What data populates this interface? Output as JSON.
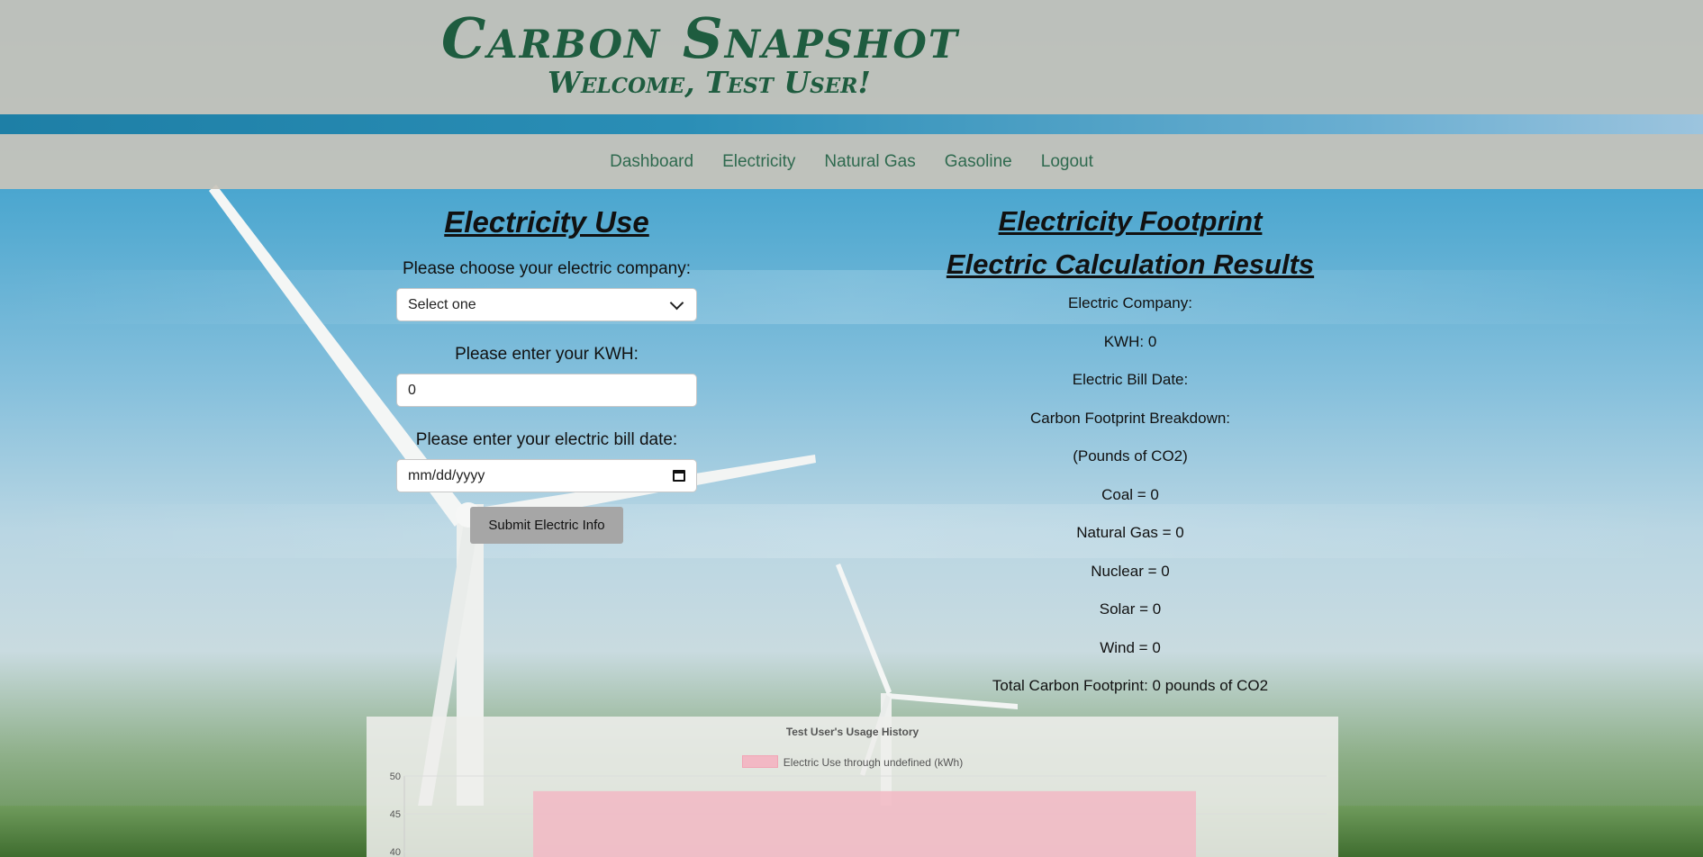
{
  "header": {
    "title": "Carbon Snapshot",
    "welcome": "Welcome, Test User!"
  },
  "nav": {
    "items": [
      "Dashboard",
      "Electricity",
      "Natural Gas",
      "Gasoline",
      "Logout"
    ]
  },
  "form": {
    "title": "Electricity Use",
    "company_label": "Please choose your electric company:",
    "company_value": "Select one",
    "kwh_label": "Please enter your KWH:",
    "kwh_value": "0",
    "date_label": "Please enter your electric bill date:",
    "date_placeholder": "mm/dd/yyyy",
    "submit_label": "Submit Electric Info"
  },
  "results": {
    "title": "Electricity Footprint",
    "subtitle": "Electric Calculation Results",
    "lines": [
      "Electric Company:",
      "KWH: 0",
      "Electric Bill Date:",
      "Carbon Footprint Breakdown:",
      "(Pounds of CO2)",
      "Coal = 0",
      "Natural Gas = 0",
      "Nuclear = 0",
      "Solar = 0",
      "Wind = 0",
      "Total Carbon Footprint: 0 pounds of CO2"
    ]
  },
  "chart_data": {
    "type": "bar",
    "title": "Test User's Usage History",
    "series": [
      {
        "name": "Electric Use through undefined (kWh)",
        "values": [
          48
        ],
        "color": "#f2b8c4"
      }
    ],
    "categories": [
      ""
    ],
    "y_ticks": [
      "50",
      "45",
      "40"
    ],
    "ylim_visible": [
      40,
      50
    ]
  }
}
